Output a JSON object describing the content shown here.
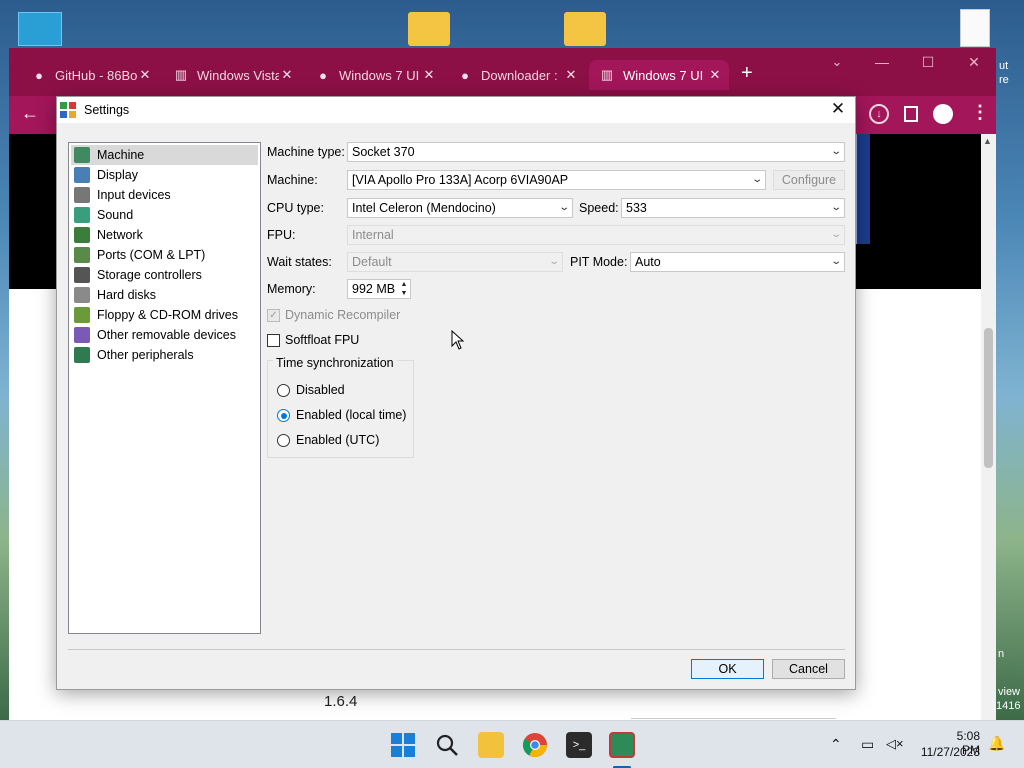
{
  "browser": {
    "tabs": [
      {
        "label": "GitHub - 86Bo",
        "icon": "github-icon"
      },
      {
        "label": "Windows Vista",
        "icon": "museum-icon"
      },
      {
        "label": "Windows 7 UI",
        "icon": "globe-icon"
      },
      {
        "label": "Downloader :",
        "icon": "globe-icon"
      },
      {
        "label": "Windows 7 UI",
        "icon": "museum-icon"
      }
    ],
    "active_tab": 4,
    "new_tab": "+",
    "accent": "#a3165a",
    "tabbar_color": "#8c1046"
  },
  "behind_page": {
    "version_text": "1.6.4",
    "right_edge_texts": [
      "ut",
      "re",
      "n",
      "view",
      "1416"
    ]
  },
  "dialog": {
    "title": "Settings",
    "close": "✕",
    "nav_items": [
      {
        "label": "Machine",
        "icon": "machine-icon",
        "selected": true
      },
      {
        "label": "Display",
        "icon": "display-icon"
      },
      {
        "label": "Input devices",
        "icon": "input-devices-icon"
      },
      {
        "label": "Sound",
        "icon": "sound-icon"
      },
      {
        "label": "Network",
        "icon": "network-icon"
      },
      {
        "label": "Ports (COM & LPT)",
        "icon": "ports-icon"
      },
      {
        "label": "Storage controllers",
        "icon": "storage-icon"
      },
      {
        "label": "Hard disks",
        "icon": "hard-disk-icon"
      },
      {
        "label": "Floppy & CD-ROM drives",
        "icon": "floppy-cdrom-icon"
      },
      {
        "label": "Other removable devices",
        "icon": "removable-icon"
      },
      {
        "label": "Other peripherals",
        "icon": "peripherals-icon"
      }
    ],
    "machine_type": {
      "label": "Machine type:",
      "value": "Socket 370"
    },
    "machine": {
      "label": "Machine:",
      "value": "[VIA Apollo Pro 133A] Acorp 6VIA90AP",
      "configure": "Configure"
    },
    "cpu_type": {
      "label": "CPU type:",
      "value": "Intel Celeron (Mendocino)"
    },
    "speed": {
      "label": "Speed:",
      "value": "533"
    },
    "fpu": {
      "label": "FPU:",
      "value": "Internal"
    },
    "wait_states": {
      "label": "Wait states:",
      "value": "Default"
    },
    "pit_mode": {
      "label": "PIT Mode:",
      "value": "Auto"
    },
    "memory": {
      "label": "Memory:",
      "value": "992 MB"
    },
    "dynamic_recompiler": {
      "label": "Dynamic Recompiler",
      "checked": true,
      "enabled": false
    },
    "softfloat_fpu": {
      "label": "Softfloat FPU",
      "checked": false
    },
    "time_sync": {
      "legend": "Time synchronization",
      "options": [
        "Disabled",
        "Enabled (local time)",
        "Enabled (UTC)"
      ],
      "selected": 1
    },
    "ok": "OK",
    "cancel": "Cancel"
  },
  "taskbar": {
    "time": "5:08 PM",
    "date": "11/27/2023",
    "apps": [
      "start-icon",
      "search-icon",
      "file-explorer-icon",
      "chrome-icon",
      "terminal-icon",
      "emulator-icon"
    ]
  }
}
